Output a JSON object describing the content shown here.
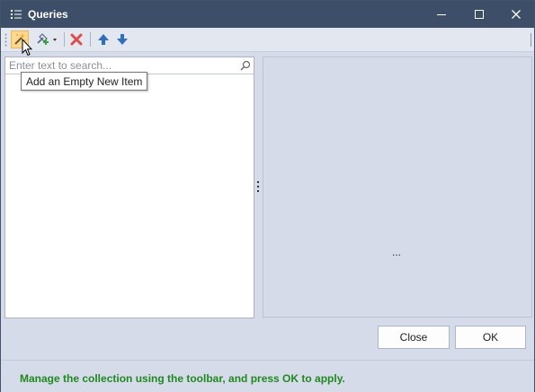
{
  "window": {
    "title": "Queries",
    "title_icon": "list-icon",
    "controls": [
      "minimize-icon",
      "maximize-icon",
      "close-icon"
    ]
  },
  "toolbar": {
    "buttons": [
      {
        "name": "add-empty-item-button",
        "icon": "wand-icon",
        "state": "hovered"
      },
      {
        "name": "add-item-dropdown-button",
        "icon": "add-dropdown-icon"
      },
      {
        "name": "delete-button",
        "icon": "delete-x-icon"
      },
      {
        "name": "move-up-button",
        "icon": "arrow-up-icon"
      },
      {
        "name": "move-down-button",
        "icon": "arrow-down-icon"
      }
    ]
  },
  "search": {
    "placeholder": "Enter text to search...",
    "value": ""
  },
  "tooltip": {
    "text": "Add an Empty New Item"
  },
  "right_panel": {
    "placeholder_text": "..."
  },
  "buttons": {
    "close_label": "Close",
    "ok_label": "OK"
  },
  "status": {
    "message": "Manage the collection using the toolbar, and press OK to apply.",
    "color": "#1e8a1e"
  },
  "colors": {
    "titlebar": "#3c4e68",
    "window_bg": "#d6dbe9",
    "hot_button": "#fcd992",
    "delete_red": "#e04a4a",
    "arrow_blue": "#2f6fc2"
  }
}
